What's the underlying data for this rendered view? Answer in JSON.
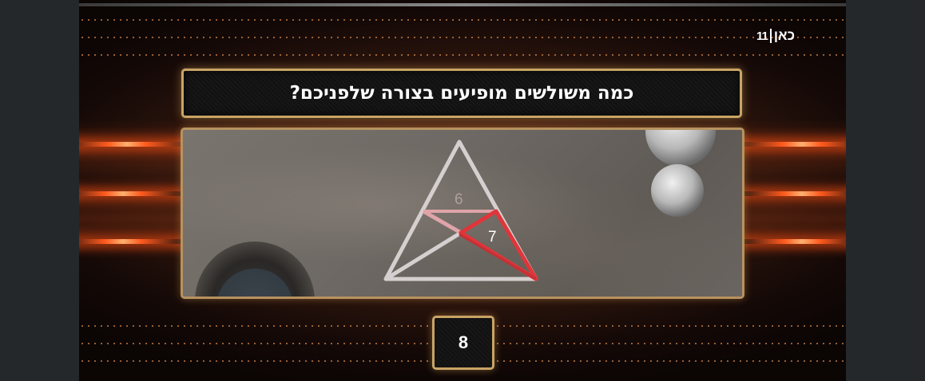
{
  "channel_logo": {
    "number": "11",
    "name": "כאן"
  },
  "question": "כמה משולשים מופיעים בצורה שלפניכם?",
  "figure": {
    "labels": {
      "white_triangle": "6",
      "red_triangle": "7"
    },
    "colors": {
      "white_lines": "#d6cfcf",
      "red_lines": "#e0353a"
    }
  },
  "answer": "8"
}
